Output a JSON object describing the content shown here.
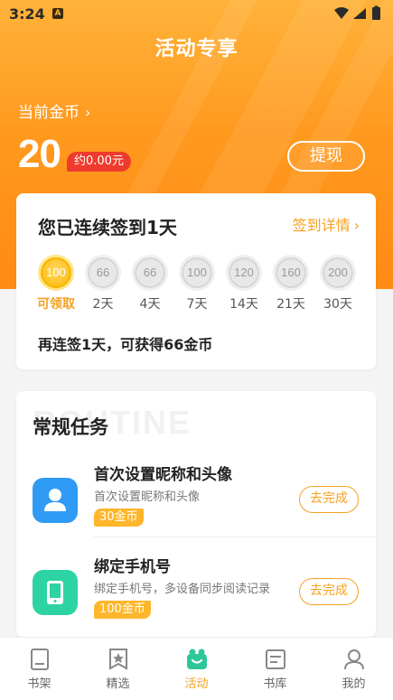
{
  "status_bar": {
    "time": "3:24",
    "notif_badge": "A"
  },
  "header": {
    "title": "活动专享"
  },
  "coins": {
    "label": "当前金币",
    "value": "20",
    "approx": "约0.00元",
    "withdraw_label": "提现"
  },
  "checkin": {
    "heading": "您已连续签到1天",
    "detail_link": "签到详情",
    "days": [
      {
        "coins": "100",
        "label": "可领取",
        "active": true
      },
      {
        "coins": "66",
        "label": "2天",
        "active": false
      },
      {
        "coins": "66",
        "label": "4天",
        "active": false
      },
      {
        "coins": "100",
        "label": "7天",
        "active": false
      },
      {
        "coins": "120",
        "label": "14天",
        "active": false
      },
      {
        "coins": "160",
        "label": "21天",
        "active": false
      },
      {
        "coins": "200",
        "label": "30天",
        "active": false
      }
    ],
    "tip": "再连签1天，可获得66金币"
  },
  "tasks": {
    "watermark": "ROUTINE",
    "heading": "常规任务",
    "items": [
      {
        "name": "首次设置昵称和头像",
        "desc": "首次设置昵称和头像",
        "reward": "30金币",
        "button": "去完成",
        "icon": "avatar-icon",
        "icon_color": "#2f9bf5"
      },
      {
        "name": "绑定手机号",
        "desc": "绑定手机号，多设备同步阅读记录",
        "reward": "100金币",
        "button": "去完成",
        "icon": "phone-icon",
        "icon_color": "#2ed3a3"
      }
    ]
  },
  "nav": {
    "items": [
      {
        "label": "书架",
        "icon": "bookshelf-icon",
        "active": false
      },
      {
        "label": "精选",
        "icon": "featured-icon",
        "active": false
      },
      {
        "label": "活动",
        "icon": "activity-icon",
        "active": true
      },
      {
        "label": "书库",
        "icon": "library-icon",
        "active": false
      },
      {
        "label": "我的",
        "icon": "profile-icon",
        "active": false
      }
    ]
  },
  "colors": {
    "accent": "#f5a121",
    "hero_top": "#ffb23a",
    "hero_bottom": "#ff8a14",
    "badge_red": "#ef3b2d"
  }
}
